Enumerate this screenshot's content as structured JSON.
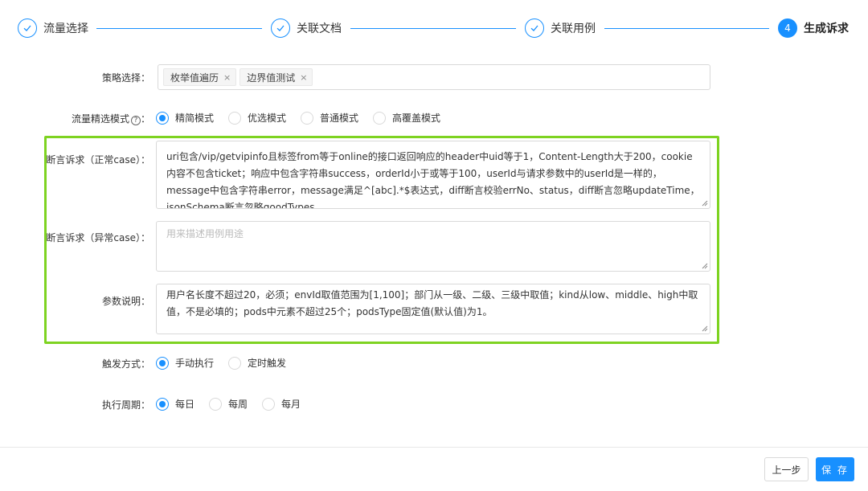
{
  "steps": [
    {
      "label": "流量选择",
      "status": "done",
      "icon": "check-icon"
    },
    {
      "label": "关联文档",
      "status": "done",
      "icon": "check-icon"
    },
    {
      "label": "关联用例",
      "status": "done",
      "icon": "check-icon"
    },
    {
      "label": "生成诉求",
      "status": "active",
      "number": "4"
    }
  ],
  "strategy": {
    "label": "策略选择：",
    "tags": [
      "枚举值遍历",
      "边界值测试"
    ],
    "remove_icon": "×"
  },
  "traffic_mode": {
    "label": "流量精选模式",
    "help_icon": "?",
    "colon": "：",
    "options": [
      "精简模式",
      "优选模式",
      "普通模式",
      "高覆盖模式"
    ],
    "selected": 0
  },
  "assert_normal": {
    "label": "断言诉求（正常case）：",
    "value": "uri包含/vip/getvipinfo且标签from等于online的接口返回响应的header中uid等于1，Content-Length大于200，cookie内容不包含ticket；响应中包含字符串success，orderId小于或等于100，userId与请求参数中的userId是一样的，message中包含字符串error，message满足^[abc].*$表达式，diff断言校验errNo、status，diff断言忽略updateTime，jsonSchema断言忽略goodTypes。"
  },
  "assert_abnormal": {
    "label": "断言诉求（异常case）：",
    "placeholder": "用来描述用例用途"
  },
  "param_desc": {
    "label": "参数说明：",
    "value": "用户名长度不超过20，必须；envId取值范围为[1,100]；部门从一级、二级、三级中取值；kind从low、middle、high中取值，不是必填的；pods中元素不超过25个；podsType固定值(默认值)为1。"
  },
  "trigger": {
    "label": "触发方式：",
    "options": [
      "手动执行",
      "定时触发"
    ],
    "selected": 0
  },
  "period": {
    "label": "执行周期：",
    "options": [
      "每日",
      "每周",
      "每月"
    ],
    "selected": 0
  },
  "footer": {
    "prev_label": "上一步",
    "save_label": "保 存"
  },
  "colors": {
    "primary": "#1890ff",
    "highlight_border": "#7ed321"
  }
}
